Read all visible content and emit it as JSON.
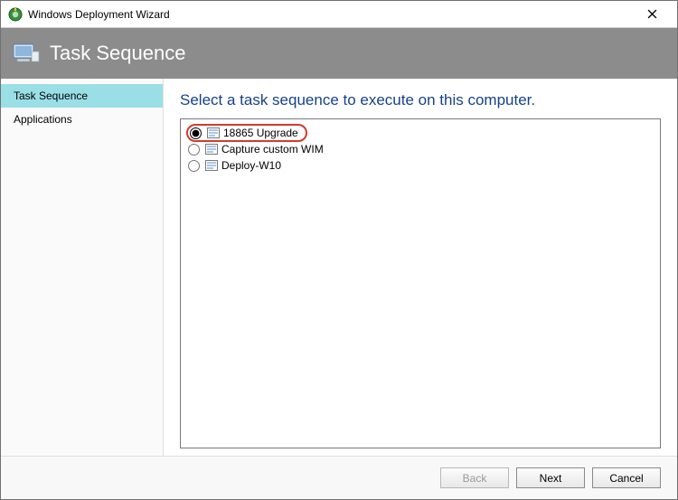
{
  "window": {
    "title": "Windows Deployment Wizard",
    "close_label": "Close"
  },
  "banner": {
    "title": "Task Sequence"
  },
  "sidebar": {
    "items": [
      {
        "label": "Task Sequence",
        "active": true
      },
      {
        "label": "Applications",
        "active": false
      }
    ]
  },
  "main": {
    "heading": "Select a task sequence to execute on this computer.",
    "task_sequences": [
      {
        "label": "18865 Upgrade",
        "selected": true,
        "highlighted": true
      },
      {
        "label": "Capture custom WIM",
        "selected": false,
        "highlighted": false
      },
      {
        "label": "Deploy-W10",
        "selected": false,
        "highlighted": false
      }
    ]
  },
  "footer": {
    "back": "Back",
    "next": "Next",
    "cancel": "Cancel",
    "back_enabled": false
  }
}
